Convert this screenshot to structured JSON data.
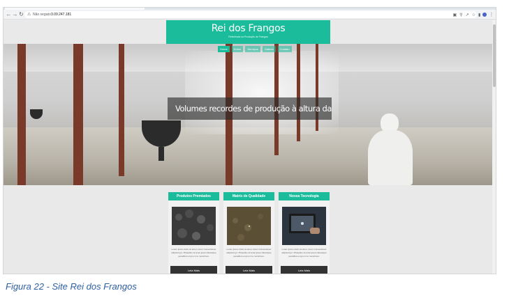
{
  "browser": {
    "security_label": "Não seguro",
    "url": "3.09.247.181"
  },
  "site": {
    "title": "Rei dos Frangos",
    "tagline": "Referência na Produção de Frangos",
    "nav": [
      "Home",
      "Sobre",
      "Serviços",
      "Galeria",
      "Contato"
    ],
    "banner_text": "Volumes recordes de produção à altura das exigência"
  },
  "cards": [
    {
      "title": "Produtos Premiados",
      "text": "Lorem ipsum dolor sit amet, lorem Consectetuer adipiscing it. Phasellus sit amet ipsum Elessique penatibus et gno in te monstrous.",
      "button": "Leia Mais"
    },
    {
      "title": "Matriz de Qualidade",
      "text": "Lorem ipsum dolor sit amet, lorem Consectetuer adipiscing it. Phasellus sit amet ipsum Elessique penatibus et gno in te monstrous.",
      "button": "Leia Mais"
    },
    {
      "title": "Nossa Tecnologia",
      "text": "Lorem ipsum dolor sit amet, lorem Consectetuer adipiscing it. Phasellus sit amet ipsum Elessique penatibus et gno in te monstrous.",
      "button": "Leia Mais"
    }
  ],
  "caption": "Figura 22 - Site Rei dos Frangos",
  "colors": {
    "accent": "#1bbc9b",
    "button": "#333333",
    "caption": "#2e5fa3"
  }
}
